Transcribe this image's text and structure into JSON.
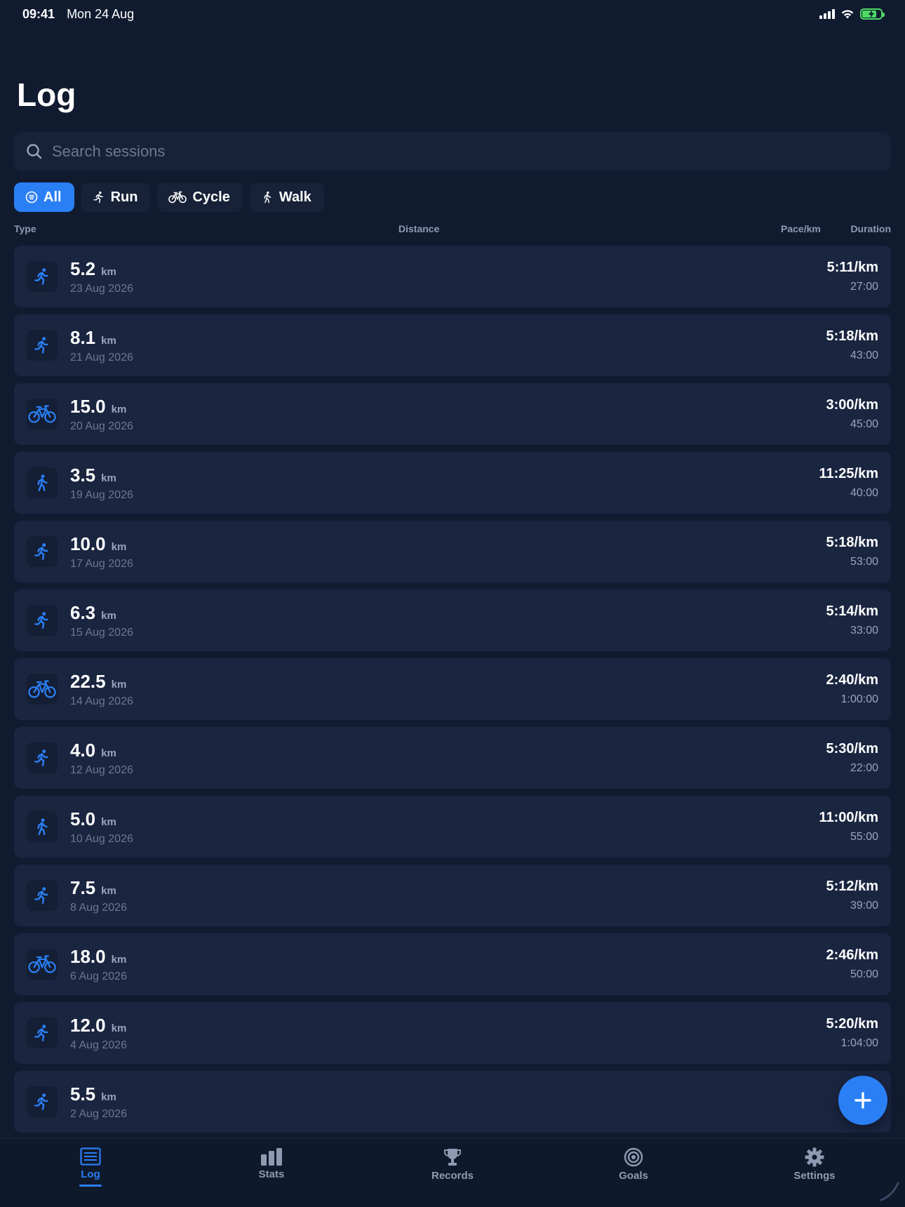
{
  "status": {
    "time": "09:41",
    "date": "Mon 24 Aug",
    "battery_color": "#4cd964"
  },
  "header": {
    "title": "Log"
  },
  "search": {
    "placeholder": "Search sessions",
    "value": ""
  },
  "filters": [
    {
      "label": "All",
      "icon": "list-icon",
      "active": true
    },
    {
      "label": "Run",
      "icon": "run-icon",
      "active": false
    },
    {
      "label": "Cycle",
      "icon": "bike-icon",
      "active": false
    },
    {
      "label": "Walk",
      "icon": "walk-icon",
      "active": false
    }
  ],
  "columns": {
    "type": "Type",
    "distance": "Distance",
    "pace": "Pace/km",
    "duration": "Duration"
  },
  "sessions": [
    {
      "type": "run",
      "distance": "5.2",
      "unit": "km",
      "date": "23 Aug 2026",
      "pace": "5:11/km",
      "duration": "27:00"
    },
    {
      "type": "run",
      "distance": "8.1",
      "unit": "km",
      "date": "21 Aug 2026",
      "pace": "5:18/km",
      "duration": "43:00"
    },
    {
      "type": "cycle",
      "distance": "15.0",
      "unit": "km",
      "date": "20 Aug 2026",
      "pace": "3:00/km",
      "duration": "45:00"
    },
    {
      "type": "walk",
      "distance": "3.5",
      "unit": "km",
      "date": "19 Aug 2026",
      "pace": "11:25/km",
      "duration": "40:00"
    },
    {
      "type": "run",
      "distance": "10.0",
      "unit": "km",
      "date": "17 Aug 2026",
      "pace": "5:18/km",
      "duration": "53:00"
    },
    {
      "type": "run",
      "distance": "6.3",
      "unit": "km",
      "date": "15 Aug 2026",
      "pace": "5:14/km",
      "duration": "33:00"
    },
    {
      "type": "cycle",
      "distance": "22.5",
      "unit": "km",
      "date": "14 Aug 2026",
      "pace": "2:40/km",
      "duration": "1:00:00"
    },
    {
      "type": "run",
      "distance": "4.0",
      "unit": "km",
      "date": "12 Aug 2026",
      "pace": "5:30/km",
      "duration": "22:00"
    },
    {
      "type": "walk",
      "distance": "5.0",
      "unit": "km",
      "date": "10 Aug 2026",
      "pace": "11:00/km",
      "duration": "55:00"
    },
    {
      "type": "run",
      "distance": "7.5",
      "unit": "km",
      "date": "8 Aug 2026",
      "pace": "5:12/km",
      "duration": "39:00"
    },
    {
      "type": "cycle",
      "distance": "18.0",
      "unit": "km",
      "date": "6 Aug 2026",
      "pace": "2:46/km",
      "duration": "50:00"
    },
    {
      "type": "run",
      "distance": "12.0",
      "unit": "km",
      "date": "4 Aug 2026",
      "pace": "5:20/km",
      "duration": "1:04:00"
    },
    {
      "type": "run",
      "distance": "5.5",
      "unit": "km",
      "date": "2 Aug 2026",
      "pace": "5:",
      "duration": ""
    }
  ],
  "fab": {
    "icon": "plus-icon"
  },
  "tabs": [
    {
      "label": "Log",
      "icon": "log-icon",
      "active": true
    },
    {
      "label": "Stats",
      "icon": "stats-icon",
      "active": false
    },
    {
      "label": "Records",
      "icon": "trophy-icon",
      "active": false
    },
    {
      "label": "Goals",
      "icon": "target-icon",
      "active": false
    },
    {
      "label": "Settings",
      "icon": "gear-icon",
      "active": false
    }
  ],
  "colors": {
    "background": "#111b30",
    "card": "#1a2540",
    "accent": "#2a7ff5",
    "muted": "#8f9ab2"
  }
}
